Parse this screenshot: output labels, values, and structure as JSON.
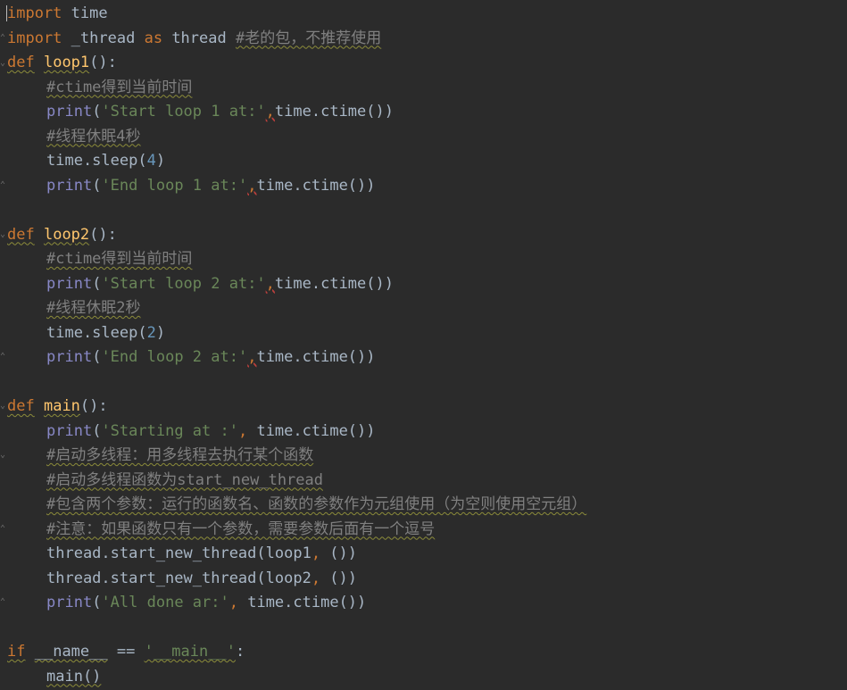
{
  "editor": {
    "language": "python",
    "lines": [
      {
        "t": "import time"
      },
      {
        "t": "import _thread as thread #老的包，不推荐使用"
      },
      {
        "t": "def loop1():"
      },
      {
        "t": "    #ctime得到当前时间"
      },
      {
        "t": "    print('Start loop 1 at:',time.ctime())"
      },
      {
        "t": "    #线程休眠4秒"
      },
      {
        "t": "    time.sleep(4)"
      },
      {
        "t": "    print('End loop 1 at:',time.ctime())"
      },
      {
        "t": ""
      },
      {
        "t": "def loop2():"
      },
      {
        "t": "    #ctime得到当前时间"
      },
      {
        "t": "    print('Start loop 2 at:',time.ctime())"
      },
      {
        "t": "    #线程休眠2秒"
      },
      {
        "t": "    time.sleep(2)"
      },
      {
        "t": "    print('End loop 2 at:',time.ctime())"
      },
      {
        "t": ""
      },
      {
        "t": "def main():"
      },
      {
        "t": "    print('Starting at :', time.ctime())"
      },
      {
        "t": "    #启动多线程：用多线程去执行某个函数"
      },
      {
        "t": "    #启动多线程函数为start_new_thread"
      },
      {
        "t": "    #包含两个参数：运行的函数名、函数的参数作为元组使用（为空则使用空元组）"
      },
      {
        "t": "    #注意：如果函数只有一个参数，需要参数后面有一个逗号"
      },
      {
        "t": "    thread.start_new_thread(loop1, ())"
      },
      {
        "t": "    thread.start_new_thread(loop2, ())"
      },
      {
        "t": "    print('All done ar:', time.ctime())"
      },
      {
        "t": ""
      },
      {
        "t": "if __name__ == '__main__':"
      },
      {
        "t": "    main()"
      }
    ],
    "colors": {
      "background": "#2b2b2b",
      "keyword": "#cc7832",
      "function": "#ffc66d",
      "builtin": "#8888c6",
      "string": "#6a8759",
      "number": "#6897bb",
      "comment": "#808080",
      "text": "#a9b7c6"
    }
  }
}
